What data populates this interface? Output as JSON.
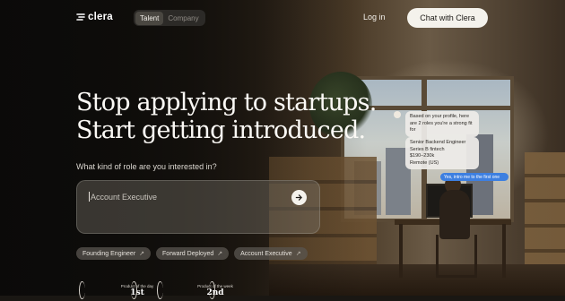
{
  "brand": {
    "name": "clera"
  },
  "nav": {
    "toggle": [
      "Talent",
      "Company"
    ],
    "login": "Log in",
    "cta": "Chat with Clera"
  },
  "hero": {
    "headline_1": "Stop applying to startups.",
    "headline_2": "Start getting introduced.",
    "question": "What kind of role are you interested in?",
    "input_placeholder": "Account Executive"
  },
  "suggestions": [
    {
      "label": "Founding Engineer"
    },
    {
      "label": "Forward Deployed"
    },
    {
      "label": "Account Executive"
    }
  ],
  "awards": [
    {
      "label": "Product of the day",
      "rank": "1st"
    },
    {
      "label": "Product of the week",
      "rank": "2nd"
    }
  ],
  "chat_preview": {
    "assistant_msg_1": "Based on your profile, here are 2 roles you're a strong fit for",
    "job_title": "Senior Backend Engineer",
    "job_company": "Series B fintech",
    "job_salary": "$190–230k",
    "job_location": "Remote (US)",
    "user_msg": "Yes, intro me to the first one"
  },
  "icons": {
    "logo": "clera-logo-icon",
    "send": "arrow-right-icon",
    "chip": "arrow-up-right-icon",
    "award": "laurel-icon"
  },
  "colors": {
    "cta_bg": "#f4f2ec",
    "user_bubble": "#3d7fe0"
  }
}
